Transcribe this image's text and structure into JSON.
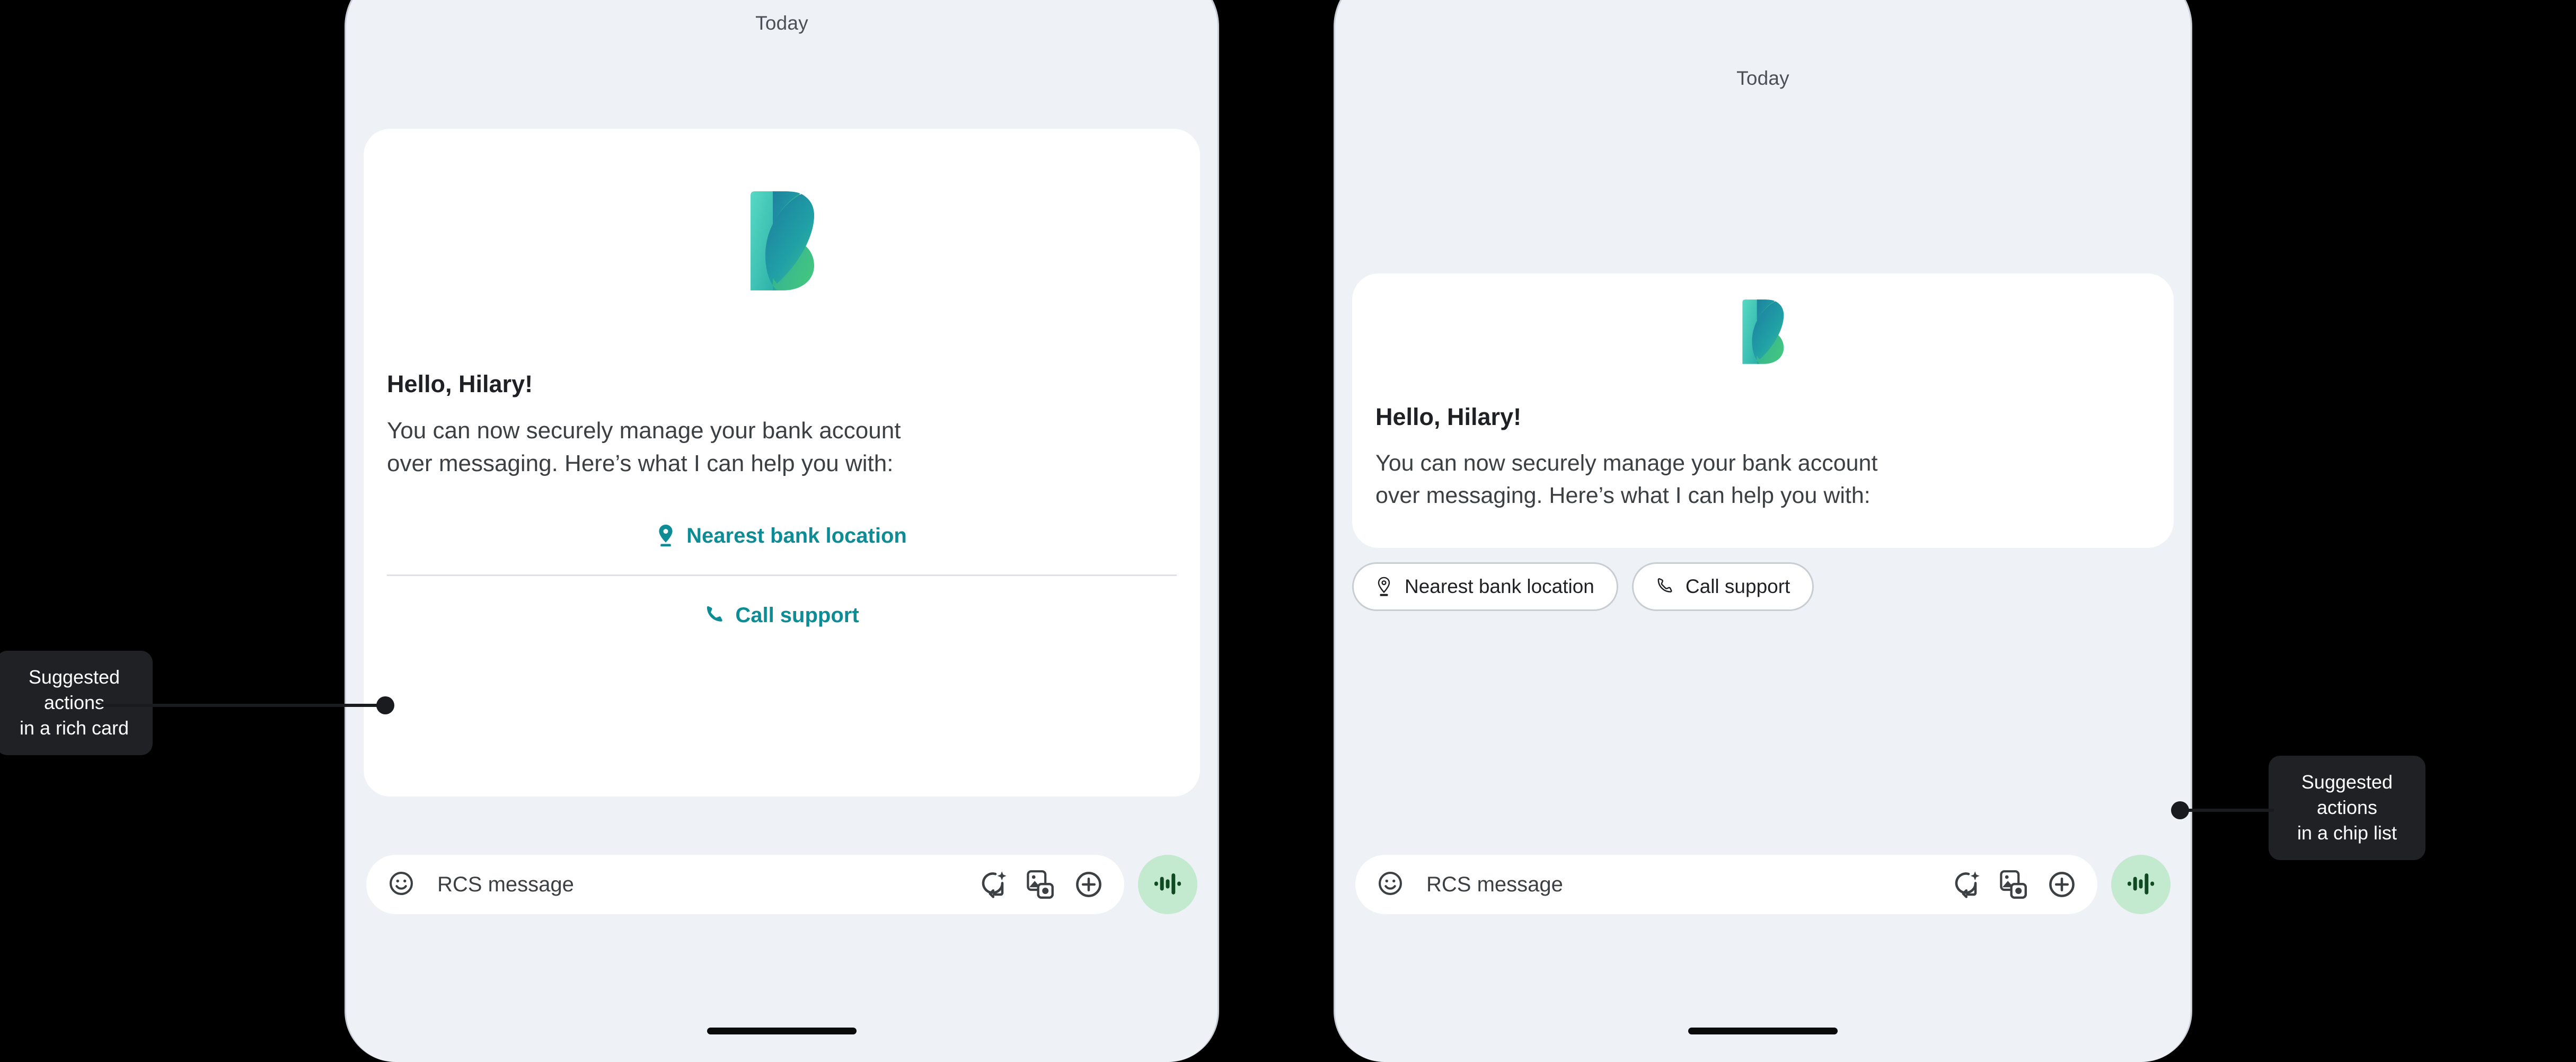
{
  "page": {
    "background_color": "#000000",
    "phone_screen_color": "#eef1f6",
    "card_color": "#ffffff",
    "accent_teal": "#0d8c96",
    "voice_button_color": "#c3e9cf",
    "voice_wave_color": "#0f4a22"
  },
  "phones": [
    {
      "id": "rich-card-phone",
      "date_separator": "Today",
      "card": {
        "logo_name": "bank-logo-b",
        "greeting": "Hello, Hilary!",
        "body": "You can now securely manage your bank account over messaging. Here’s what I can help you with:",
        "suggested_actions": [
          {
            "icon": "location-pin-icon",
            "label": "Nearest bank location"
          },
          {
            "icon": "phone-call-icon",
            "label": "Call support"
          }
        ]
      },
      "input_bar": {
        "emoji_icon": "emoji-smiley-icon",
        "placeholder": "RCS message",
        "icons": [
          "magic-compose-icon",
          "gallery-camera-icon",
          "plus-circle-icon"
        ],
        "voice_icon": "voice-waveform-icon"
      }
    },
    {
      "id": "chip-list-phone",
      "date_separator": "Today",
      "card": {
        "logo_name": "bank-logo-b",
        "greeting": "Hello, Hilary!",
        "body": "You can now securely manage your bank account over messaging. Here’s what I can help you with:"
      },
      "chips": [
        {
          "icon": "location-pin-icon",
          "label": "Nearest bank location"
        },
        {
          "icon": "phone-call-icon",
          "label": "Call support"
        }
      ],
      "input_bar": {
        "emoji_icon": "emoji-smiley-icon",
        "placeholder": "RCS message",
        "icons": [
          "magic-compose-icon",
          "gallery-camera-icon",
          "plus-circle-icon"
        ],
        "voice_icon": "voice-waveform-icon"
      }
    }
  ],
  "annotations": [
    {
      "id": "annotation-rich-card",
      "line1": "Suggested actions",
      "line2": "in a rich card"
    },
    {
      "id": "annotation-chip-list",
      "line1": "Suggested actions",
      "line2": "in a chip list"
    }
  ]
}
